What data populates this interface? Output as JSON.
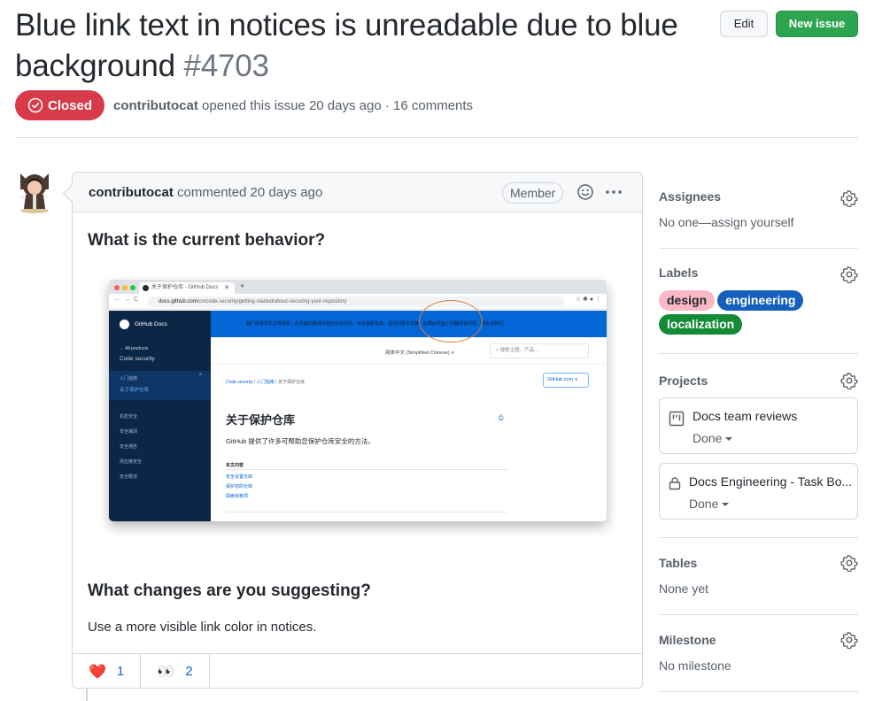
{
  "issue": {
    "title": "Blue link text in notices is unreadable due to blue background",
    "number": "#4703",
    "state": "Closed",
    "author": "contributocat",
    "opened_text": "opened this issue 20 days ago · 16 comments"
  },
  "header_actions": {
    "edit_label": "Edit",
    "new_issue_label": "New issue"
  },
  "comment": {
    "author": "contributocat",
    "action_text": "commented 20 days ago",
    "role_badge": "Member",
    "heading_1": "What is the current behavior?",
    "heading_2": "What changes are you suggesting?",
    "paragraph": "Use a more visible link color in notices.",
    "reactions": [
      {
        "icon": "heart-icon",
        "glyph": "❤️",
        "count": "1"
      },
      {
        "icon": "eyes-icon",
        "glyph": "👀",
        "count": "2"
      }
    ],
    "embedded_screenshot": {
      "tab_title": "关于保护仓库 - GitHub Docs",
      "url_domain": "docs.github.com",
      "url_path": "/cn/code-security/getting-started/about-securing-your-repository",
      "site_name": "GitHub Docs",
      "back_link": "← All products",
      "product": "Code security",
      "nav_section": "入门指南",
      "nav_current": "关于保护仓库",
      "nav_items": [
        "机密安全",
        "安全漏洞",
        "安全通告",
        "供应链安全",
        "安全概述"
      ],
      "banner_text": "我们经常发布文档更新，此页面的翻译可能仍在进行中。有关最新信息，请访问英文文档。如果此页面上的翻译有问题，请告诉我们。",
      "language": "简体中文 (Simplified Chinese) ∨",
      "search_placeholder": "搜索主题、产品...",
      "breadcrumb": [
        "Code security",
        "入门指南",
        "关于保护仓库"
      ],
      "version": "GitHub.com ∨",
      "page_heading": "关于保护仓库",
      "intro": "GitHub 提供了许多可帮助您保护仓库安全的方法。",
      "toc_heading": "本文内容",
      "toc_items": [
        "安全设置仓库",
        "保护您的仓库",
        "探索依赖项"
      ]
    }
  },
  "sidebar": {
    "assignees": {
      "title": "Assignees",
      "value": "No one—assign yourself"
    },
    "labels": {
      "title": "Labels",
      "items": [
        {
          "name": "design",
          "bg": "#f9b8c4",
          "fg": "#24292f"
        },
        {
          "name": "engineering",
          "bg": "#1560bd",
          "fg": "#ffffff"
        },
        {
          "name": "localization",
          "bg": "#138a36",
          "fg": "#ffffff"
        }
      ]
    },
    "projects": {
      "title": "Projects",
      "items": [
        {
          "name": "Docs team reviews",
          "status": "Done",
          "icon": "project-board-icon"
        },
        {
          "name": "Docs Engineering - Task Bo...",
          "status": "Done",
          "icon": "lock-icon"
        }
      ]
    },
    "tables": {
      "title": "Tables",
      "value": "None yet"
    },
    "milestone": {
      "title": "Milestone",
      "value": "No milestone"
    }
  },
  "colors": {
    "closed": "#d73a49",
    "primary_button": "#2da44e",
    "link": "#0969da"
  }
}
